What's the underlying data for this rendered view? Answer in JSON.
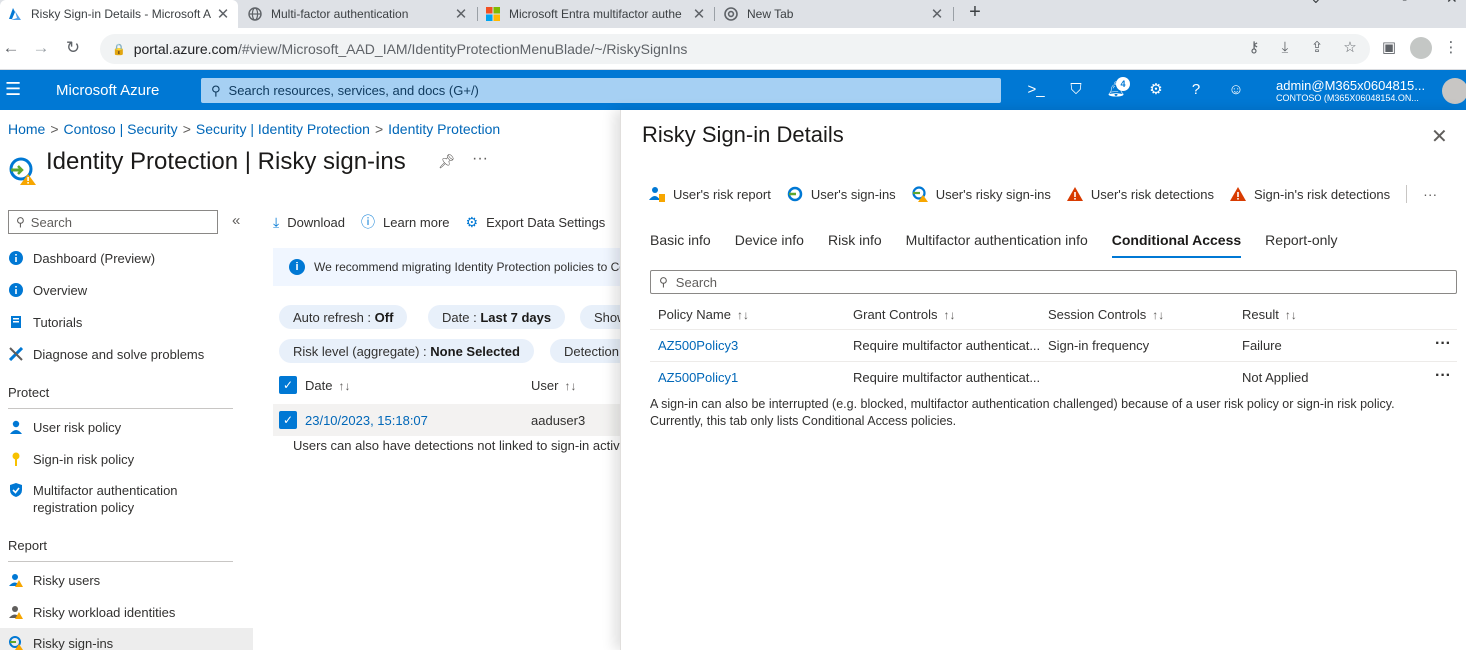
{
  "browser": {
    "tabs": [
      {
        "title": "Risky Sign-in Details - Microsoft A",
        "icon": "azure-icon",
        "active": true
      },
      {
        "title": "Multi-factor authentication",
        "icon": "globe-icon",
        "active": false
      },
      {
        "title": "Microsoft Entra multifactor authe",
        "icon": "microsoft-icon",
        "active": false
      },
      {
        "title": "New Tab",
        "icon": "chrome-icon",
        "active": false
      }
    ],
    "url_host": "portal.azure.com",
    "url_path": "/#view/Microsoft_AAD_IAM/IdentityProtectionMenuBlade/~/RiskySignIns"
  },
  "azure_header": {
    "brand": "Microsoft Azure",
    "search_placeholder": "Search resources, services, and docs (G+/)",
    "notification_count": "4",
    "account_user": "admin@M365x0604815...",
    "account_tenant": "CONTOSO (M365X06048154.ON..."
  },
  "breadcrumb": [
    "Home",
    "Contoso | Security",
    "Security | Identity Protection",
    "Identity Protection"
  ],
  "page_title": "Identity Protection | Risky sign-ins",
  "sidebar": {
    "search_placeholder": "Search",
    "items_top": [
      {
        "label": "Dashboard (Preview)",
        "icon": "info-icon"
      },
      {
        "label": "Overview",
        "icon": "info-icon"
      },
      {
        "label": "Tutorials",
        "icon": "book-icon"
      },
      {
        "label": "Diagnose and solve problems",
        "icon": "wrench-icon"
      }
    ],
    "section_protect": "Protect",
    "items_protect": [
      {
        "label": "User risk policy",
        "icon": "user-icon"
      },
      {
        "label": "Sign-in risk policy",
        "icon": "key-icon"
      },
      {
        "label": "Multifactor authentication registration policy",
        "icon": "shield-icon"
      }
    ],
    "section_report": "Report",
    "items_report": [
      {
        "label": "Risky users",
        "icon": "risky-user-icon"
      },
      {
        "label": "Risky workload identities",
        "icon": "risky-workload-icon"
      },
      {
        "label": "Risky sign-ins",
        "icon": "risky-signin-icon"
      }
    ]
  },
  "content": {
    "commands": [
      "Download",
      "Learn more",
      "Export Data Settings"
    ],
    "info_text": "We recommend migrating Identity Protection policies to Conditional Access",
    "filters": {
      "auto_refresh_label": "Auto refresh : ",
      "auto_refresh_value": "Off",
      "date_label": "Date : ",
      "date_value": "Last 7 days",
      "show_label": "Show dates as : Local",
      "risk_level_label": "Risk level (aggregate) : ",
      "risk_level_value": "None Selected",
      "detection_label": "Detection type(s)"
    },
    "columns": [
      "Date",
      "User"
    ],
    "rows": [
      {
        "date": "23/10/2023, 15:18:07",
        "user": "aaduser3"
      }
    ],
    "note": "Users can also have detections not linked to sign-in activity."
  },
  "panel": {
    "title": "Risky Sign-in Details",
    "toolbar": [
      {
        "label": "User's risk report",
        "icon": "user-risk-report-icon"
      },
      {
        "label": "User's sign-ins",
        "icon": "signin-icon"
      },
      {
        "label": "User's risky sign-ins",
        "icon": "risky-signin-icon"
      },
      {
        "label": "User's risk detections",
        "icon": "warning-icon"
      },
      {
        "label": "Sign-in's risk detections",
        "icon": "warning-icon"
      }
    ],
    "tabs": [
      "Basic info",
      "Device info",
      "Risk info",
      "Multifactor authentication info",
      "Conditional Access",
      "Report-only"
    ],
    "active_tab": "Conditional Access",
    "search_placeholder": "Search",
    "table": {
      "columns": [
        "Policy Name",
        "Grant Controls",
        "Session Controls",
        "Result"
      ],
      "rows": [
        {
          "policy": "AZ500Policy3",
          "grant": "Require multifactor authenticat...",
          "session": "Sign-in frequency",
          "result": "Failure"
        },
        {
          "policy": "AZ500Policy1",
          "grant": "Require multifactor authenticat...",
          "session": "",
          "result": "Not Applied"
        }
      ]
    },
    "note_line1": "A sign-in can also be interrupted (e.g. blocked, multifactor authentication challenged) because of a user risk policy or sign-in risk policy.",
    "note_line2": "Currently, this tab only lists Conditional Access policies."
  },
  "colors": {
    "azure_blue": "#0078d4",
    "link": "#0067b8",
    "warning": "#d83b01"
  }
}
